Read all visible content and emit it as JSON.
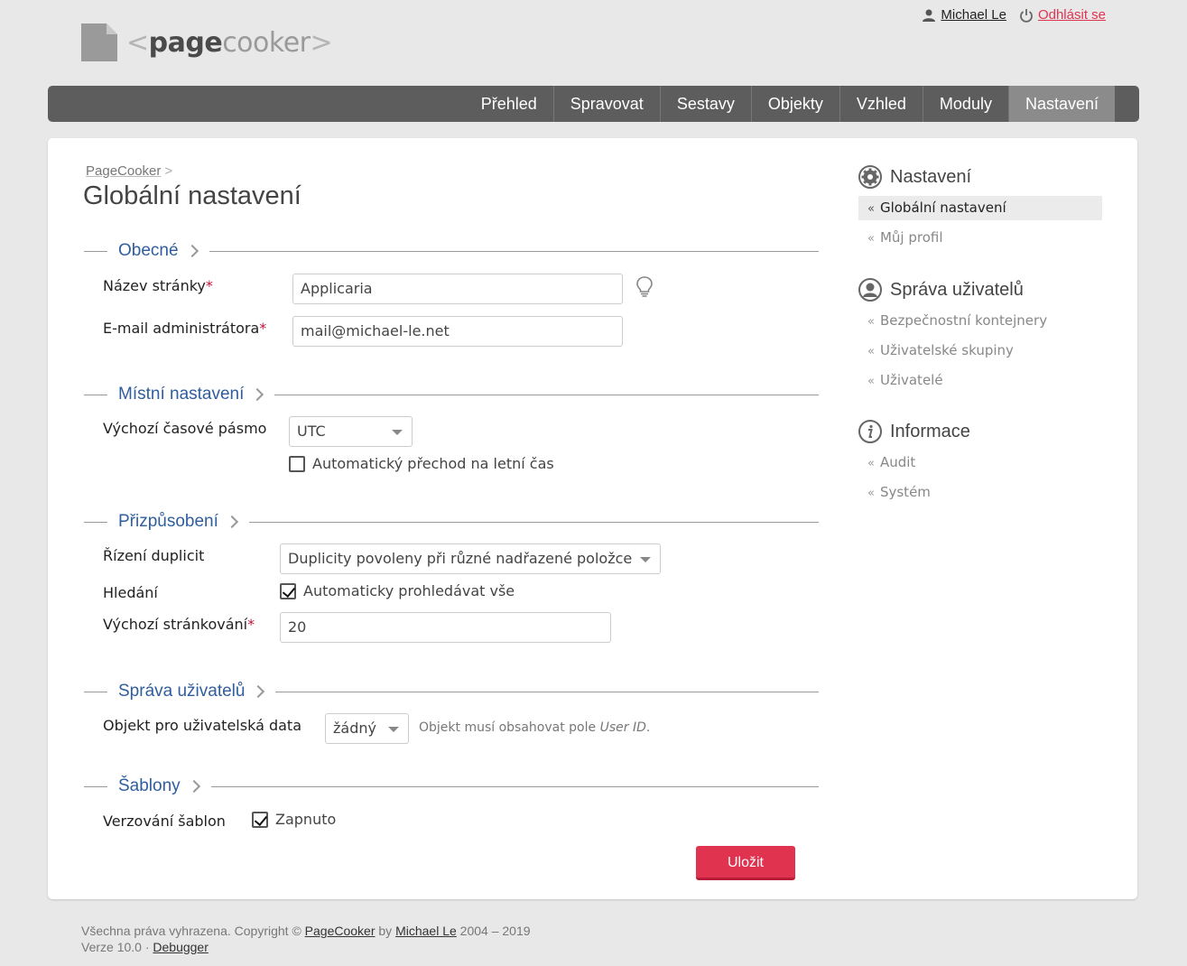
{
  "header": {
    "logo": {
      "bracket_open": "<",
      "bold": "page",
      "light": "cooker",
      "bracket_close": ">"
    },
    "user": "Michael Le",
    "logout": "Odhlásit se"
  },
  "nav": {
    "items": [
      "Přehled",
      "Spravovat",
      "Sestavy",
      "Objekty",
      "Vzhled",
      "Moduly",
      "Nastavení"
    ],
    "active": "Nastavení"
  },
  "breadcrumb": {
    "home": "PageCooker",
    "sep": ">"
  },
  "page_title": "Globální nastavení",
  "sections": {
    "general": {
      "title": "Obecné",
      "site_name_label": "Název stránky",
      "site_name_value": "Applicaria",
      "admin_email_label": "E-mail administrátora",
      "admin_email_value": "mail@michael-le.net"
    },
    "local": {
      "title": "Místní nastavení",
      "timezone_label": "Výchozí časové pásmo",
      "timezone_value": "UTC",
      "dst_label": "Automatický přechod na letní čas",
      "dst_checked": false
    },
    "custom": {
      "title": "Přizpůsobení",
      "dup_label": "Řízení duplicit",
      "dup_value": "Duplicity povoleny při různé nadřazené položce",
      "search_label": "Hledání",
      "search_check_label": "Automaticky prohledávat vše",
      "search_checked": true,
      "paging_label": "Výchozí stránkování",
      "paging_value": "20"
    },
    "users": {
      "title": "Správa uživatelů",
      "object_label": "Objekt pro uživatelská data",
      "object_value": "žádný",
      "hint_text": "Objekt musí obsahovat pole ",
      "hint_em": "User ID",
      "hint_end": "."
    },
    "templates": {
      "title": "Šablony",
      "versioning_label": "Verzování šablon",
      "versioning_check_label": "Zapnuto",
      "versioning_checked": true
    }
  },
  "required_mark": "*",
  "save_label": "Uložit",
  "sidebar": {
    "groups": [
      {
        "title": "Nastavení",
        "icon": "gear-icon",
        "items": [
          "Globální nastavení",
          "Můj profil"
        ],
        "active": "Globální nastavení"
      },
      {
        "title": "Správa uživatelů",
        "icon": "user-circle-icon",
        "items": [
          "Bezpečnostní kontejnery",
          "Uživatelské skupiny",
          "Uživatelé"
        ]
      },
      {
        "title": "Informace",
        "icon": "info-icon",
        "items": [
          "Audit",
          "Systém"
        ]
      }
    ],
    "bullet": "«"
  },
  "footer": {
    "line1_pre": "Všechna práva vyhrazena. Copyright © ",
    "brand": "PageCooker",
    "by": " by ",
    "author": "Michael Le",
    "years": " 2004 – 2019",
    "version": "Verze 10.0",
    "dot": " · ",
    "debugger": "Debugger"
  },
  "colors": {
    "accent": "#e0334f",
    "nav_bg": "#5d5d5d",
    "nav_active": "#8b8b8b",
    "section_title": "#2f5e9e"
  }
}
